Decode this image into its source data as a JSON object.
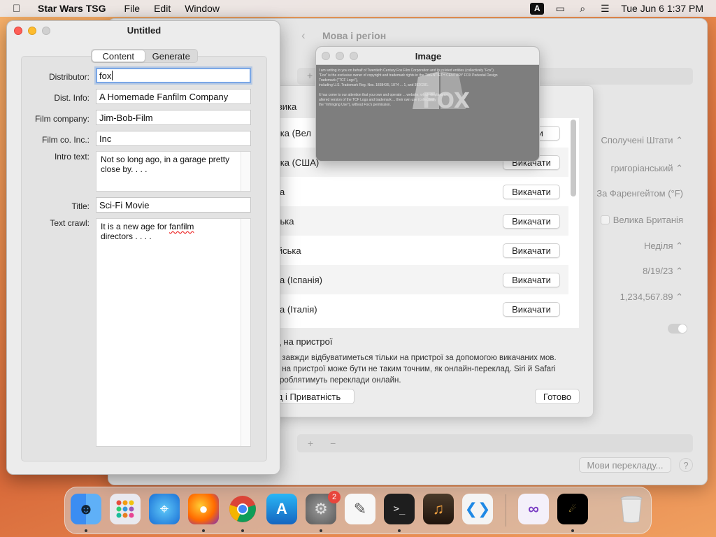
{
  "menubar": {
    "app_name": "Star Wars TSG",
    "menus": [
      "File",
      "Edit",
      "Window"
    ],
    "input_source": "A",
    "datetime": "Tue Jun 6  1:37 PM"
  },
  "settings_window": {
    "title": "Мова і регіон",
    "region": "Сполучені Штати",
    "calendar": "григоріанський",
    "temperature": "За Фаренгейтом (°F)",
    "measurement": "Велика Британія",
    "first_day": "Неділя",
    "date_format": "8/19/23",
    "number_format": "1,234,567.89",
    "translation_languages_button": "Мови перекладу...",
    "help": "?"
  },
  "sheet": {
    "title": "для вика",
    "languages": [
      {
        "label": "ька (Вел",
        "button": "ачати"
      },
      {
        "label": "ька (США)",
        "button": "Викачати"
      },
      {
        "label": "ка",
        "button": "Викачати"
      },
      {
        "label": "ська",
        "button": "Викачати"
      },
      {
        "label": "ійська",
        "button": "Викачати"
      },
      {
        "label": "ка (Іспанія)",
        "button": "Викачати"
      },
      {
        "label": "ка (Італія)",
        "button": "Викачати"
      }
    ],
    "on_device_label": "ад на пристрої",
    "description": [
      "ад завжди відбуватиметься тільки на пристрої за допомогою викачаних мов.",
      "ад на пристрої може бути не таким точним, як онлайн-переклад. Siri й Safari",
      "оброблятимуть переклади онлайн."
    ],
    "privacy_button": "д і Приватність",
    "done_button": "Готово"
  },
  "image_window": {
    "title": "Image",
    "letter_lines": [
      "I am writing to you on behalf of Twentieth Century Fox Film Corporation and its related entities (collectively \"Fox\").",
      "\"Fox\" is the exclusive owner of copyright and trademark rights in the TWENTIETH CENTURY FOX Pedestal Design",
      "Trademark (\"TCF Logo\"),",
      "including U.S. Trademark Reg. Nos. 1838435, 1874 ... 1, and 3920281.",
      "",
      "It has come to our attention that you own and operate ... website, which displays an",
      "altered version of the TCF Logo and trademark ... their own use (collectively",
      "the \"Infringing Use\"), without Fox's permission."
    ]
  },
  "main_window": {
    "title": "Untitled",
    "tabs": [
      "Content",
      "Generate"
    ],
    "fields": {
      "distributor_label": "Distributor:",
      "distributor_value": "fox",
      "dist_info_label": "Dist. Info:",
      "dist_info_value": "A Homemade Fanfilm Company",
      "film_company_label": "Film company:",
      "film_company_value": "Jim-Bob-Film",
      "film_co_inc_label": "Film co. Inc.:",
      "film_co_inc_value": "Inc",
      "intro_text_label": "Intro text:",
      "intro_text_value": "Not so long ago, in a garage pretty close by. . . .",
      "title_label": "Title:",
      "title_value": "Sci-Fi Movie",
      "text_crawl_label": "Text crawl:",
      "text_crawl_line1_a": "It is a new age for ",
      "text_crawl_line1_b": "fanfilm",
      "text_crawl_line2": "directors . . . ."
    }
  },
  "dock": {
    "badge_count": "2",
    "apps": [
      "finder-icon",
      "launchpad-icon",
      "safari-icon",
      "firefox-icon",
      "chrome-icon",
      "app-store-icon",
      "system-settings-icon",
      "textedit-icon",
      "terminal-icon",
      "garageband-icon",
      "vscode-icon",
      "visual-studio-icon",
      "star-wars-tsg-icon",
      "trash-icon"
    ]
  }
}
